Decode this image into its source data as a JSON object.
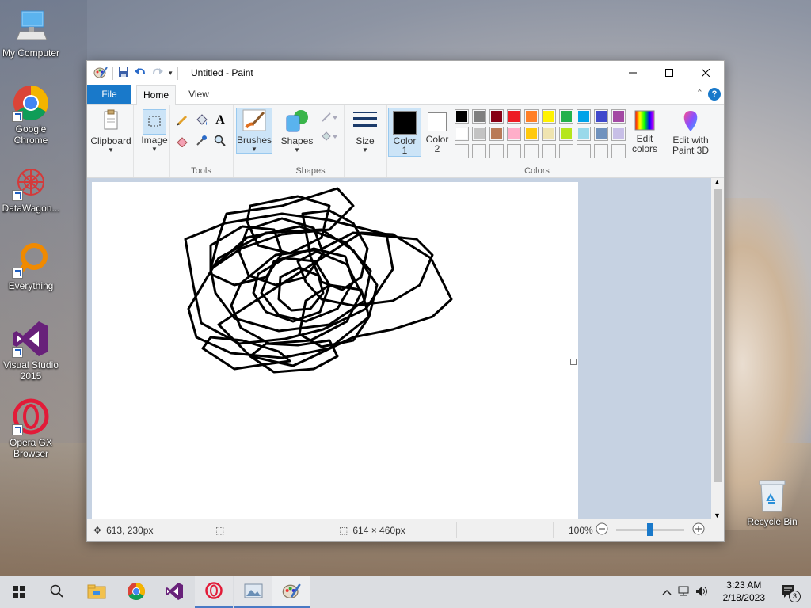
{
  "desktop": {
    "icons": [
      {
        "label": "My Computer",
        "icon": "computer-icon"
      },
      {
        "label": "Google Chrome",
        "icon": "chrome-icon"
      },
      {
        "label": "DataWagon...",
        "icon": "datawagon-icon"
      },
      {
        "label": "Everything",
        "icon": "everything-search-icon"
      },
      {
        "label": "Visual Studio 2015",
        "icon": "visual-studio-icon"
      },
      {
        "label": "Opera GX Browser",
        "icon": "opera-gx-icon"
      }
    ],
    "recycle_bin": "Recycle Bin"
  },
  "window": {
    "title": "Untitled - Paint",
    "tabs": {
      "file": "File",
      "home": "Home",
      "view": "View"
    },
    "help": "?"
  },
  "ribbon": {
    "clipboard": "Clipboard",
    "image": "Image",
    "tools_group": "Tools",
    "brushes": "Brushes",
    "shapes": "Shapes",
    "shapes_group": "Shapes",
    "size": "Size",
    "color1": "Color 1",
    "color2": "Color 2",
    "colors_group": "Colors",
    "edit_colors": "Edit colors",
    "edit_paint3d": "Edit with Paint 3D",
    "palette_row1": [
      "#000000",
      "#7f7f7f",
      "#880015",
      "#ed1c24",
      "#ff7f27",
      "#fff200",
      "#22b14c",
      "#00a2e8",
      "#3f48cc",
      "#a349a4"
    ],
    "palette_row2": [
      "#ffffff",
      "#c3c3c3",
      "#b97a57",
      "#ffaec9",
      "#ffc90e",
      "#efe4b0",
      "#b5e61d",
      "#99d9ea",
      "#7092be",
      "#c8bfe7"
    ],
    "color1_value": "#000000",
    "color2_value": "#ffffff"
  },
  "status": {
    "cursor_pos": "613, 230px",
    "canvas_size": "614 × 460px",
    "zoom": "100%",
    "zoom_slider_fraction": 0.5
  },
  "taskbar": {
    "time": "3:23 AM",
    "date": "2/18/2023",
    "notifications": "3"
  }
}
